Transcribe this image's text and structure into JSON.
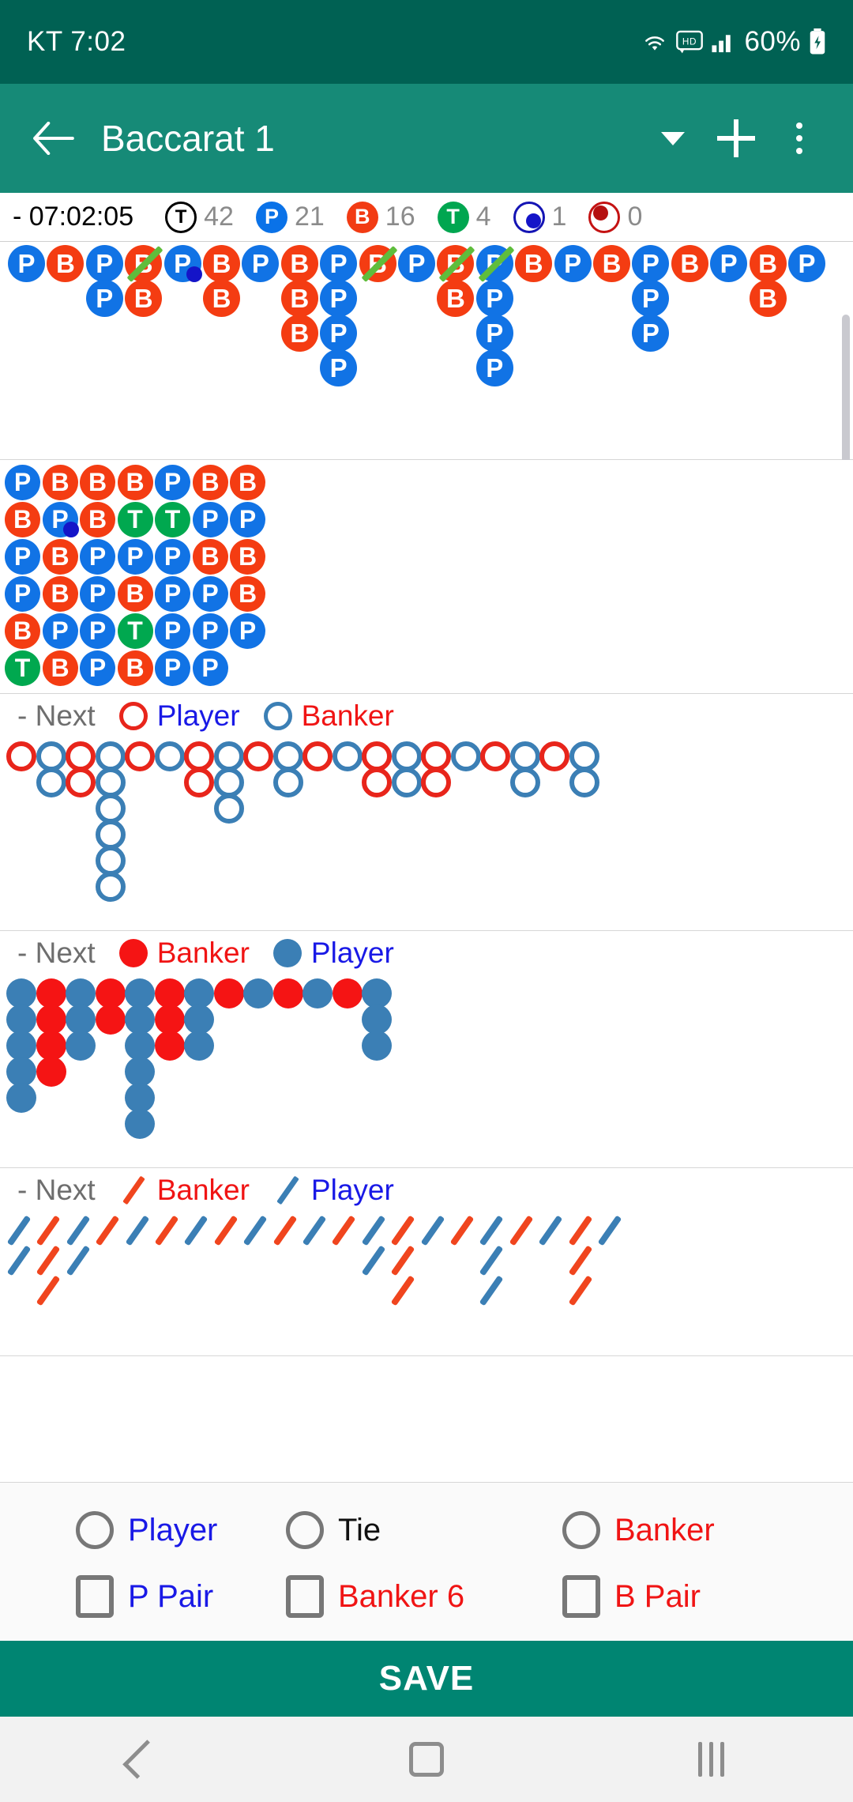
{
  "status_bar": {
    "carrier_time": "KT 7:02",
    "battery": "60%",
    "icons": [
      "wifi-icon",
      "hd-icon",
      "signal-icon",
      "battery-charging-icon"
    ]
  },
  "app_bar": {
    "back_icon": "back-arrow-icon",
    "title": "Baccarat 1",
    "dropdown_icon": "caret-down-icon",
    "add_icon": "plus-icon",
    "overflow_icon": "more-vertical-icon"
  },
  "stats": {
    "clock": "- 07:02:05",
    "items": [
      {
        "key": "total",
        "glyph": "T",
        "value": "42",
        "color": "#000000"
      },
      {
        "key": "player",
        "glyph": "P",
        "value": "21",
        "color": "#0a72e8"
      },
      {
        "key": "banker",
        "glyph": "B",
        "value": "16",
        "color": "#f23b13"
      },
      {
        "key": "tie",
        "glyph": "T",
        "value": "4",
        "color": "#00a650"
      },
      {
        "key": "player_pair",
        "glyph": "",
        "value": "1",
        "color": "#1414b4"
      },
      {
        "key": "banker_pair",
        "glyph": "",
        "value": "0",
        "color": "#c41212"
      }
    ]
  },
  "roads": {
    "big_road": {
      "name": "big-road",
      "columns": [
        {
          "cells": [
            {
              "v": "P"
            }
          ]
        },
        {
          "cells": [
            {
              "v": "B"
            }
          ]
        },
        {
          "cells": [
            {
              "v": "P"
            },
            {
              "v": "P"
            }
          ]
        },
        {
          "cells": [
            {
              "v": "B",
              "tie": true
            },
            {
              "v": "B"
            }
          ]
        },
        {
          "cells": [
            {
              "v": "P",
              "pair": "blue"
            }
          ]
        },
        {
          "cells": [
            {
              "v": "B"
            },
            {
              "v": "B"
            }
          ]
        },
        {
          "cells": [
            {
              "v": "P"
            }
          ]
        },
        {
          "cells": [
            {
              "v": "B"
            },
            {
              "v": "B"
            },
            {
              "v": "B"
            }
          ]
        },
        {
          "cells": [
            {
              "v": "P"
            },
            {
              "v": "P"
            },
            {
              "v": "P"
            },
            {
              "v": "P"
            }
          ]
        },
        {
          "cells": [
            {
              "v": "B",
              "tie": true
            }
          ]
        },
        {
          "cells": [
            {
              "v": "P"
            }
          ]
        },
        {
          "cells": [
            {
              "v": "B",
              "tie": true
            },
            {
              "v": "B"
            }
          ]
        },
        {
          "cells": [
            {
              "v": "P",
              "tie": true
            },
            {
              "v": "P"
            },
            {
              "v": "P"
            },
            {
              "v": "P"
            }
          ]
        },
        {
          "cells": [
            {
              "v": "B"
            }
          ]
        },
        {
          "cells": [
            {
              "v": "P"
            }
          ]
        },
        {
          "cells": [
            {
              "v": "B"
            }
          ]
        },
        {
          "cells": [
            {
              "v": "P"
            },
            {
              "v": "P"
            },
            {
              "v": "P"
            }
          ]
        },
        {
          "cells": [
            {
              "v": "B"
            }
          ]
        },
        {
          "cells": [
            {
              "v": "P"
            }
          ]
        },
        {
          "cells": [
            {
              "v": "B"
            },
            {
              "v": "B"
            }
          ]
        },
        {
          "cells": [
            {
              "v": "P"
            }
          ]
        }
      ]
    },
    "bead_plate": {
      "name": "bead-plate",
      "rows": [
        [
          {
            "v": "P"
          },
          {
            "v": "B"
          },
          {
            "v": "B"
          },
          {
            "v": "B"
          },
          {
            "v": "P"
          },
          {
            "v": "B"
          },
          {
            "v": "B"
          }
        ],
        [
          {
            "v": "B"
          },
          {
            "v": "P",
            "pair": "blue"
          },
          {
            "v": "B"
          },
          {
            "v": "T"
          },
          {
            "v": "T"
          },
          {
            "v": "P"
          },
          {
            "v": "P"
          }
        ],
        [
          {
            "v": "P"
          },
          {
            "v": "B"
          },
          {
            "v": "P"
          },
          {
            "v": "P"
          },
          {
            "v": "P"
          },
          {
            "v": "B"
          },
          {
            "v": "B"
          }
        ],
        [
          {
            "v": "P"
          },
          {
            "v": "B"
          },
          {
            "v": "P"
          },
          {
            "v": "B"
          },
          {
            "v": "P"
          },
          {
            "v": "P"
          },
          {
            "v": "B"
          }
        ],
        [
          {
            "v": "B"
          },
          {
            "v": "P"
          },
          {
            "v": "P"
          },
          {
            "v": "T"
          },
          {
            "v": "P"
          },
          {
            "v": "P"
          },
          {
            "v": "P"
          }
        ],
        [
          {
            "v": "T"
          },
          {
            "v": "B"
          },
          {
            "v": "P"
          },
          {
            "v": "B"
          },
          {
            "v": "P"
          },
          {
            "v": "P"
          },
          null
        ]
      ]
    },
    "big_eye_boy": {
      "name": "big-eye-boy-road",
      "legend": {
        "next_label": "- Next",
        "a_icon": "red-ring-icon",
        "a_label": "Player",
        "b_icon": "blue-ring-icon",
        "b_label": "Banker"
      },
      "columns": [
        [
          "red"
        ],
        [
          "blue",
          "blue"
        ],
        [
          "red",
          "red"
        ],
        [
          "blue",
          "blue",
          "blue",
          "blue",
          "blue",
          "blue"
        ],
        [
          "red"
        ],
        [
          "blue"
        ],
        [
          "red",
          "red"
        ],
        [
          "blue",
          "blue",
          "blue"
        ],
        [
          "red"
        ],
        [
          "blue",
          "blue"
        ],
        [
          "red"
        ],
        [
          "blue"
        ],
        [
          "red",
          "red"
        ],
        [
          "blue",
          "blue"
        ],
        [
          "red",
          "red"
        ],
        [
          "blue"
        ],
        [
          "red"
        ],
        [
          "blue",
          "blue"
        ],
        [
          "red"
        ],
        [
          "blue",
          "blue"
        ]
      ]
    },
    "small_road": {
      "name": "small-road",
      "legend": {
        "next_label": "- Next",
        "a_icon": "red-dot-icon",
        "a_label": "Banker",
        "b_icon": "blue-dot-icon",
        "b_label": "Player"
      },
      "columns": [
        [
          "blue",
          "blue",
          "blue",
          "blue",
          "blue"
        ],
        [
          "red",
          "red",
          "red",
          "red"
        ],
        [
          "blue",
          "blue",
          "blue"
        ],
        [
          "red",
          "red"
        ],
        [
          "blue",
          "blue",
          "blue",
          "blue",
          "blue",
          "blue"
        ],
        [
          "red",
          "red",
          "red"
        ],
        [
          "blue",
          "blue",
          "blue"
        ],
        [
          "red"
        ],
        [
          "blue"
        ],
        [
          "red"
        ],
        [
          "blue"
        ],
        [
          "red"
        ],
        [
          "blue",
          "blue",
          "blue"
        ]
      ]
    },
    "cockroach_pig": {
      "name": "cockroach-pig-road",
      "legend": {
        "next_label": "- Next",
        "a_icon": "red-slash-icon",
        "a_label": "Banker",
        "b_icon": "blue-slash-icon",
        "b_label": "Player"
      },
      "columns": [
        [
          "blue",
          "blue"
        ],
        [
          "red",
          "red",
          "red"
        ],
        [
          "blue",
          "blue"
        ],
        [
          "red"
        ],
        [
          "blue"
        ],
        [
          "red"
        ],
        [
          "blue"
        ],
        [
          "red"
        ],
        [
          "blue"
        ],
        [
          "red"
        ],
        [
          "blue"
        ],
        [
          "red"
        ],
        [
          "blue",
          "blue"
        ],
        [
          "red",
          "red",
          "red"
        ],
        [
          "blue"
        ],
        [
          "red"
        ],
        [
          "blue",
          "blue",
          "blue"
        ],
        [
          "red"
        ],
        [
          "blue"
        ],
        [
          "red",
          "red",
          "red"
        ],
        [
          "blue"
        ]
      ]
    }
  },
  "controls": {
    "row1": [
      {
        "type": "radio",
        "name": "player",
        "label": "Player",
        "color": "blue",
        "checked": false
      },
      {
        "type": "radio",
        "name": "tie",
        "label": "Tie",
        "color": "black",
        "checked": false
      },
      {
        "type": "radio",
        "name": "banker",
        "label": "Banker",
        "color": "red",
        "checked": false
      }
    ],
    "row2": [
      {
        "type": "checkbox",
        "name": "p-pair",
        "label": "P Pair",
        "color": "blue",
        "checked": false
      },
      {
        "type": "checkbox",
        "name": "banker-6",
        "label": "Banker 6",
        "color": "red",
        "checked": false
      },
      {
        "type": "checkbox",
        "name": "b-pair",
        "label": "B Pair",
        "color": "red",
        "checked": false
      }
    ]
  },
  "save_button": {
    "label": "SAVE"
  },
  "nav_bar": {
    "back_icon": "nav-back-icon",
    "home_icon": "nav-home-icon",
    "recents_icon": "nav-recents-icon"
  },
  "colors": {
    "primary": "#168a77",
    "status_bar": "#006153",
    "save": "#008572",
    "player": "#1173e5",
    "banker": "#f43c12",
    "tie": "#00a84f",
    "ring_red": "#e8251b",
    "ring_blue": "#3b7fb5",
    "slash_red": "#f0451e",
    "slash_blue": "#3b7fb5",
    "tie_slash": "#5fbd3c"
  }
}
